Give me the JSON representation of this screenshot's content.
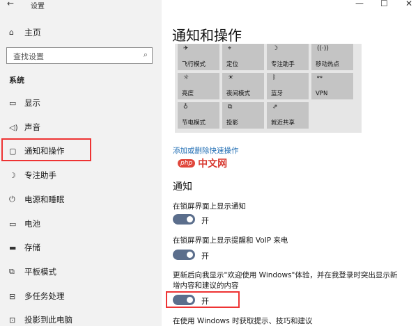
{
  "window": {
    "title": "设置",
    "back_glyph": "←",
    "minimize_glyph": "—",
    "maximize_glyph": "☐",
    "close_glyph": "✕"
  },
  "sidebar": {
    "home_label": "主页",
    "search_placeholder": "查找设置",
    "section_label": "系统",
    "items": [
      {
        "label": "显示",
        "icon": "monitor-icon"
      },
      {
        "label": "声音",
        "icon": "speaker-icon"
      },
      {
        "label": "通知和操作",
        "icon": "message-icon",
        "selected": true
      },
      {
        "label": "专注助手",
        "icon": "moon-icon"
      },
      {
        "label": "电源和睡眠",
        "icon": "power-icon"
      },
      {
        "label": "电池",
        "icon": "battery-icon"
      },
      {
        "label": "存储",
        "icon": "storage-icon"
      },
      {
        "label": "平板模式",
        "icon": "tablet-icon"
      },
      {
        "label": "多任务处理",
        "icon": "multitask-icon"
      },
      {
        "label": "投影到此电脑",
        "icon": "projector-icon"
      }
    ]
  },
  "main": {
    "title": "通知和操作",
    "quick_actions": [
      {
        "label": "飞行模式",
        "icon": "airplane-icon"
      },
      {
        "label": "定位",
        "icon": "location-icon"
      },
      {
        "label": "专注助手",
        "icon": "moon-icon"
      },
      {
        "label": "移动热点",
        "icon": "hotspot-icon"
      },
      {
        "label": "亮度",
        "icon": "brightness-icon"
      },
      {
        "label": "夜间模式",
        "icon": "night-light-icon"
      },
      {
        "label": "蓝牙",
        "icon": "bluetooth-icon"
      },
      {
        "label": "VPN",
        "icon": "vpn-icon"
      },
      {
        "label": "节电模式",
        "icon": "battery-saver-icon"
      },
      {
        "label": "投影",
        "icon": "project-icon"
      },
      {
        "label": "就近共享",
        "icon": "nearby-share-icon"
      }
    ],
    "edit_link": "添加或删除快速操作",
    "notifications_heading": "通知",
    "settings": [
      {
        "label": "在锁屏界面上显示通知",
        "toggle": "开"
      },
      {
        "label": "在锁屏界面上显示提醒和 VoIP 来电",
        "toggle": "开"
      },
      {
        "label": "更新后向我显示\"欢迎使用 Windows\"体验，并在我登录时突出显示新增内容和建议的内容",
        "toggle": "开"
      },
      {
        "label": "在使用 Windows 时获取提示、技巧和建议"
      }
    ]
  },
  "watermark": {
    "badge": "php",
    "text": "中文网"
  },
  "colors": {
    "accent": "#5b6e8c",
    "highlight": "#e33333",
    "link": "#2470b5"
  }
}
